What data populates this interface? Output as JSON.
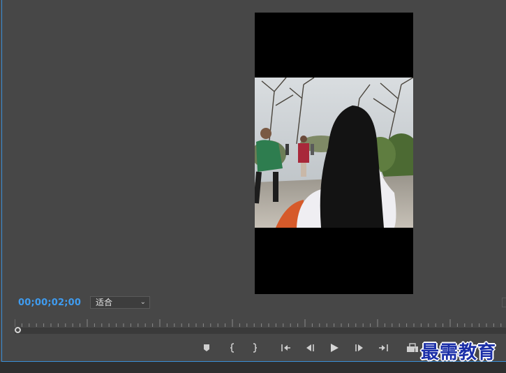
{
  "monitor": {
    "timecode": "00;00;02;00",
    "zoom_level": "适合",
    "accent_color": "#3b8fd8",
    "timecode_color": "#3f9cf0"
  },
  "transport": {
    "buttons": [
      {
        "name": "add-marker-button",
        "icon": "marker-icon"
      },
      {
        "name": "mark-in-button",
        "icon": "mark-in-icon"
      },
      {
        "name": "mark-out-button",
        "icon": "mark-out-icon"
      },
      {
        "name": "go-to-in-button",
        "icon": "go-to-in-icon"
      },
      {
        "name": "step-back-button",
        "icon": "step-back-icon"
      },
      {
        "name": "play-button",
        "icon": "play-icon"
      },
      {
        "name": "step-forward-button",
        "icon": "step-forward-icon"
      },
      {
        "name": "go-to-out-button",
        "icon": "go-to-out-icon"
      },
      {
        "name": "export-frame-button",
        "icon": "export-frame-icon"
      }
    ]
  },
  "watermark": {
    "text": "最需教育"
  }
}
